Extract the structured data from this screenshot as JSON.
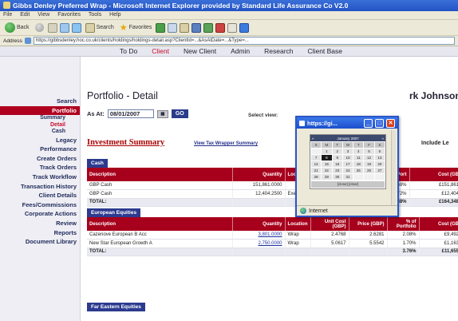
{
  "browser": {
    "title": "Gibbs Denley Preferred Wrap - Microsoft Internet Explorer provided by Standard Life Assurance Co V2.0",
    "menu": [
      "File",
      "Edit",
      "View",
      "Favorites",
      "Tools",
      "Help"
    ],
    "toolbar": {
      "back": "Back",
      "search": "Search",
      "favorites": "Favorites"
    },
    "address_label": "Address",
    "address_url": "https://gibbsdenley.hoc.co.uk/clients/holdings/holdings-detail.asp?ClientId=...&AsAtDate=...&Type=..."
  },
  "appnav": {
    "items": [
      "To Do",
      "Client",
      "New Client",
      "Admin",
      "Research",
      "Client Base"
    ],
    "active_index": 1
  },
  "sidebar": {
    "items": [
      {
        "label": "Search"
      },
      {
        "label": "Portfolio",
        "active": true
      },
      {
        "label": "Summary",
        "sub": true
      },
      {
        "label": "Detail",
        "sub": true,
        "active": true
      },
      {
        "label": "Cash",
        "sub": true
      },
      {
        "label": "Legacy"
      },
      {
        "label": "Performance"
      },
      {
        "label": "Create Orders"
      },
      {
        "label": "Track Orders"
      },
      {
        "label": "Track Workflow"
      },
      {
        "label": "Transaction History"
      },
      {
        "label": "Client Details"
      },
      {
        "label": "Fees/Commissions"
      },
      {
        "label": "Corporate Actions"
      },
      {
        "label": "Review"
      },
      {
        "label": "Reports"
      },
      {
        "label": "Document Library"
      }
    ]
  },
  "main": {
    "page_title": "Portfolio - Detail",
    "user_name": "rk Johnson -",
    "as_at_label": "As At:",
    "as_at_value": "08/01/2007",
    "go_label": "GO",
    "select_view_label": "Select view:",
    "section_title": "Investment Summary",
    "wrapper_link": "View Tax Wrapper Summary",
    "include_label": "Include Le"
  },
  "cash": {
    "group": "Cash",
    "headers": [
      "Description",
      "Quantity",
      "Loc",
      "",
      "",
      "% of Port",
      "Cost (GB"
    ],
    "rows": [
      [
        "GBP Cash",
        "151,861.0000",
        "",
        "",
        "",
        "9.68%",
        "£151,861"
      ],
      [
        "GBP Cash",
        "12,404.2500",
        "Exe",
        "",
        "",
        "0.72%",
        "£12,404"
      ]
    ],
    "total": [
      "TOTAL:",
      "",
      "",
      "",
      "",
      "9.38%",
      "£164,348"
    ]
  },
  "european": {
    "group": "European Equities",
    "headers": [
      "Description",
      "Quantity",
      "Location",
      "Unit Cost (GBP)",
      "Price (GBP)",
      "% of Portfolio",
      "Cost (GB"
    ],
    "rows": [
      [
        "Cazenove European B Acc",
        "3,801.0000",
        "Wrap",
        "2.4768",
        "2.6281",
        "2.08%",
        "£9,492"
      ],
      [
        "New Star European Growth A",
        "2,750.0000",
        "Wrap",
        "5.0617",
        "5.5542",
        "1.70%",
        "£1,163"
      ]
    ],
    "total": [
      "TOTAL:",
      "",
      "",
      "",
      "",
      "3.76%",
      "£11,655"
    ]
  },
  "fareast": {
    "group": "Far Eastern Equities"
  },
  "popup": {
    "title": "https://gi...",
    "month": "January 2007",
    "dow": [
      "S",
      "M",
      "T",
      "W",
      "T",
      "F",
      "S"
    ],
    "days": [
      "",
      "1",
      "2",
      "3",
      "4",
      "5",
      "6",
      "7",
      "8",
      "9",
      "10",
      "11",
      "12",
      "13",
      "14",
      "15",
      "16",
      "17",
      "18",
      "19",
      "20",
      "21",
      "22",
      "23",
      "24",
      "25",
      "26",
      "27",
      "28",
      "29",
      "30",
      "31",
      "",
      "",
      ""
    ],
    "selected_day": "8",
    "footer": "[close] [clear]",
    "status": "Internet"
  },
  "colors": {
    "brand_red": "#a7001c",
    "nav_blue": "#2c3b8f",
    "titlebar_blue": "#2253c4"
  }
}
